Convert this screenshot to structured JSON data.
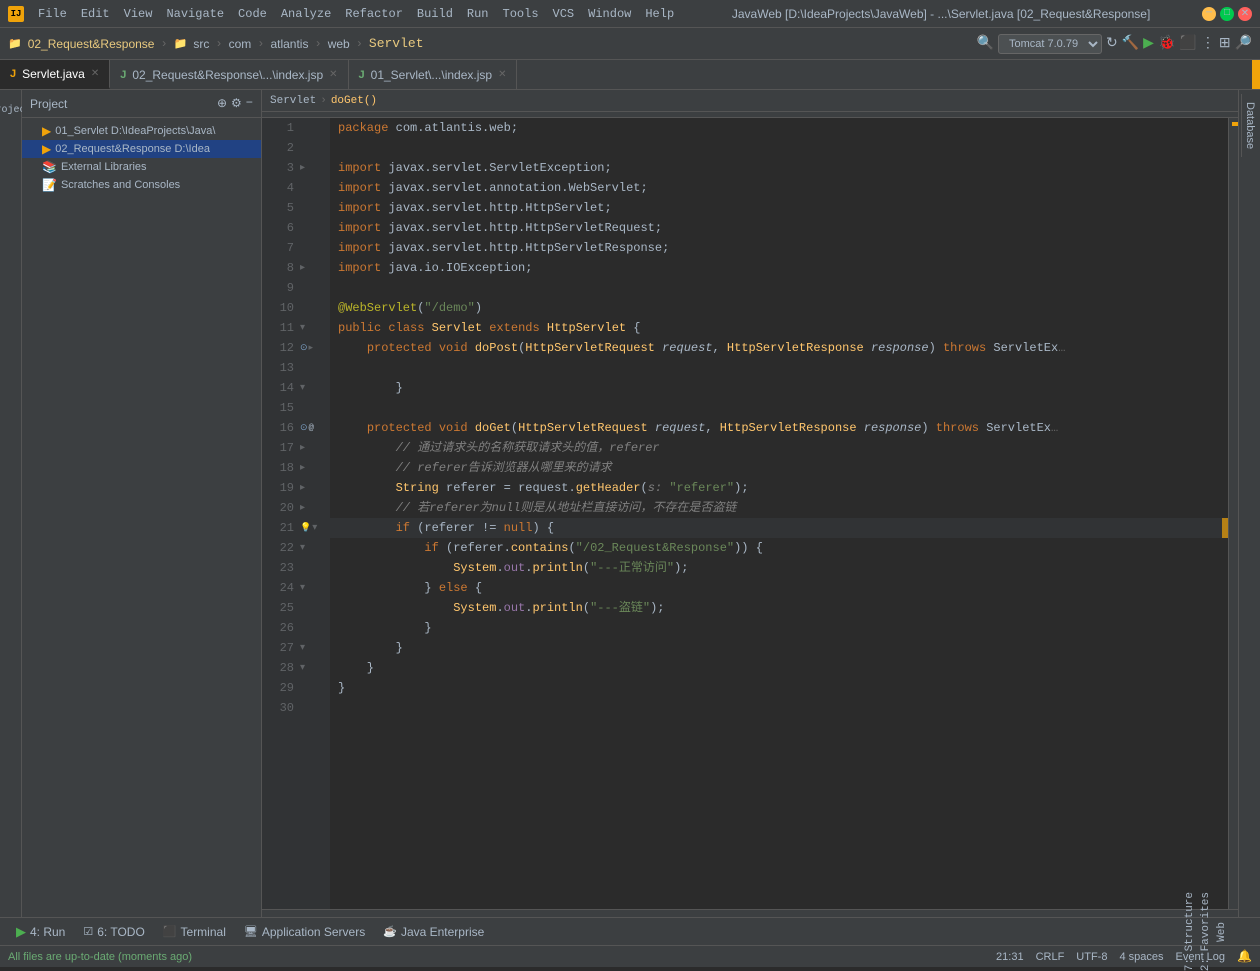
{
  "titleBar": {
    "appIcon": "IJ",
    "menus": [
      "File",
      "Edit",
      "View",
      "Navigate",
      "Code",
      "Analyze",
      "Refactor",
      "Build",
      "Run",
      "Tools",
      "VCS",
      "Window",
      "Help"
    ],
    "title": "JavaWeb [D:\\IdeaProjects\\JavaWeb] - ...\\Servlet.java [02_Request&Response]",
    "windowControls": [
      "minimize",
      "maximize",
      "close"
    ]
  },
  "toolbar": {
    "projectName": "02_Request&Response",
    "breadcrumbs": [
      "src",
      "com",
      "atlantis",
      "web",
      "Servlet"
    ],
    "tomcatLabel": "Tomcat 7.0.79",
    "buttons": [
      "refresh",
      "build",
      "run",
      "debug",
      "stop",
      "more"
    ]
  },
  "tabs": [
    {
      "label": "Servlet.java",
      "type": "java",
      "active": true
    },
    {
      "label": "02_Request&Response\\...\\index.jsp",
      "type": "jsp",
      "active": false
    },
    {
      "label": "01_Servlet\\...\\index.jsp",
      "type": "jsp",
      "active": false
    }
  ],
  "sidebar": {
    "title": "Project",
    "items": [
      {
        "label": "01_Servlet  D:\\IdeaProjects\\Java\\",
        "indent": 1,
        "type": "project"
      },
      {
        "label": "02_Request&Response  D:\\Idea",
        "indent": 1,
        "type": "project",
        "selected": true
      },
      {
        "label": "External Libraries",
        "indent": 1,
        "type": "lib"
      },
      {
        "label": "Scratches and Consoles",
        "indent": 1,
        "type": "scratch"
      }
    ]
  },
  "editorBreadcrumb": {
    "file": "Servlet",
    "method": "doGet()"
  },
  "codeLines": [
    {
      "num": 1,
      "content": "    package com.atlantis.web;"
    },
    {
      "num": 2,
      "content": ""
    },
    {
      "num": 3,
      "content": "    import javax.servlet.ServletException;"
    },
    {
      "num": 4,
      "content": "    import javax.servlet.annotation.WebServlet;"
    },
    {
      "num": 5,
      "content": "    import javax.servlet.http.HttpServlet;"
    },
    {
      "num": 6,
      "content": "    import javax.servlet.http.HttpServletRequest;"
    },
    {
      "num": 7,
      "content": "    import javax.servlet.http.HttpServletResponse;"
    },
    {
      "num": 8,
      "content": "    import java.io.IOException;"
    },
    {
      "num": 9,
      "content": ""
    },
    {
      "num": 10,
      "content": "    @WebServlet(\"/demo\")"
    },
    {
      "num": 11,
      "content": "    public class Servlet extends HttpServlet {"
    },
    {
      "num": 12,
      "content": "        protected void doPost(HttpServletRequest request, HttpServletResponse response) throws ServletEx…"
    },
    {
      "num": 13,
      "content": ""
    },
    {
      "num": 14,
      "content": "        }"
    },
    {
      "num": 15,
      "content": ""
    },
    {
      "num": 16,
      "content": "        protected void doGet(HttpServletRequest request, HttpServletResponse response) throws ServletEx…"
    },
    {
      "num": 17,
      "content": "            // 通过请求头的名称获取请求头的值，referer"
    },
    {
      "num": 18,
      "content": "            // referer告诉浏览器从哪里来的请求"
    },
    {
      "num": 19,
      "content": "            String referer = request.getHeader(s: \"referer\");"
    },
    {
      "num": 20,
      "content": "            // 若referer为null则是从地址栏直接访问，不存在是否盗链"
    },
    {
      "num": 21,
      "content": "            if (referer != null) {"
    },
    {
      "num": 22,
      "content": "                if (referer.contains(\"/02_Request&Response\")) {"
    },
    {
      "num": 23,
      "content": "                    System.out.println(\"---正常访问\");"
    },
    {
      "num": 24,
      "content": "                } else {"
    },
    {
      "num": 25,
      "content": "                    System.out.println(\"---盗链\");"
    },
    {
      "num": 26,
      "content": "                }"
    },
    {
      "num": 27,
      "content": "            }"
    },
    {
      "num": 28,
      "content": "        }"
    },
    {
      "num": 29,
      "content": "    }"
    },
    {
      "num": 30,
      "content": ""
    }
  ],
  "bottomTabs": [
    {
      "icon": "▶",
      "label": "4: Run"
    },
    {
      "icon": "☑",
      "label": "6: TODO"
    },
    {
      "icon": "⬛",
      "label": "Terminal"
    },
    {
      "icon": "🖥",
      "label": "Application Servers"
    },
    {
      "icon": "☕",
      "label": "Java Enterprise"
    }
  ],
  "statusBar": {
    "message": "All files are up-to-date (moments ago)",
    "time": "21:31",
    "encoding": "CRLF",
    "charset": "UTF-8",
    "indent": "4 spaces"
  }
}
